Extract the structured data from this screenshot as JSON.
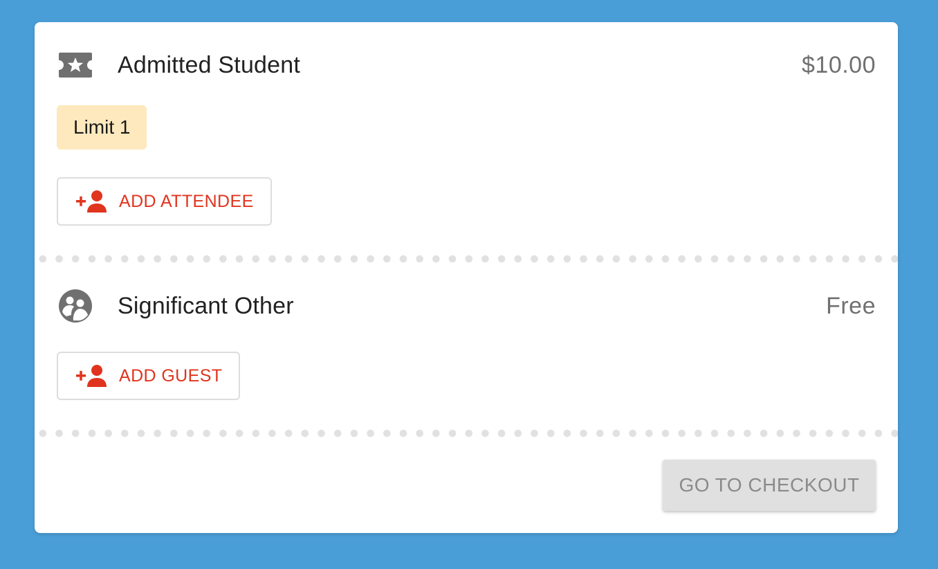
{
  "tickets": [
    {
      "icon": "ticket-star-icon",
      "name": "Admitted Student",
      "price": "$10.00",
      "limit_label": "Limit 1",
      "add_button_label": "ADD ATTENDEE",
      "add_button_icon": "add-person-icon"
    },
    {
      "icon": "significant-other-icon",
      "name": "Significant Other",
      "price": "Free",
      "add_button_label": "ADD GUEST",
      "add_button_icon": "add-person-icon"
    }
  ],
  "checkout": {
    "label": "GO TO CHECKOUT",
    "enabled": false
  },
  "colors": {
    "background": "#4a9ed8",
    "card": "#ffffff",
    "accent": "#e0341e",
    "limit_badge": "#fde9bd",
    "icon_gray": "#707070",
    "divider_dots": "#e1e1e1",
    "checkout_disabled_bg": "#e0e0e0",
    "checkout_disabled_text": "#8a8a8a"
  }
}
